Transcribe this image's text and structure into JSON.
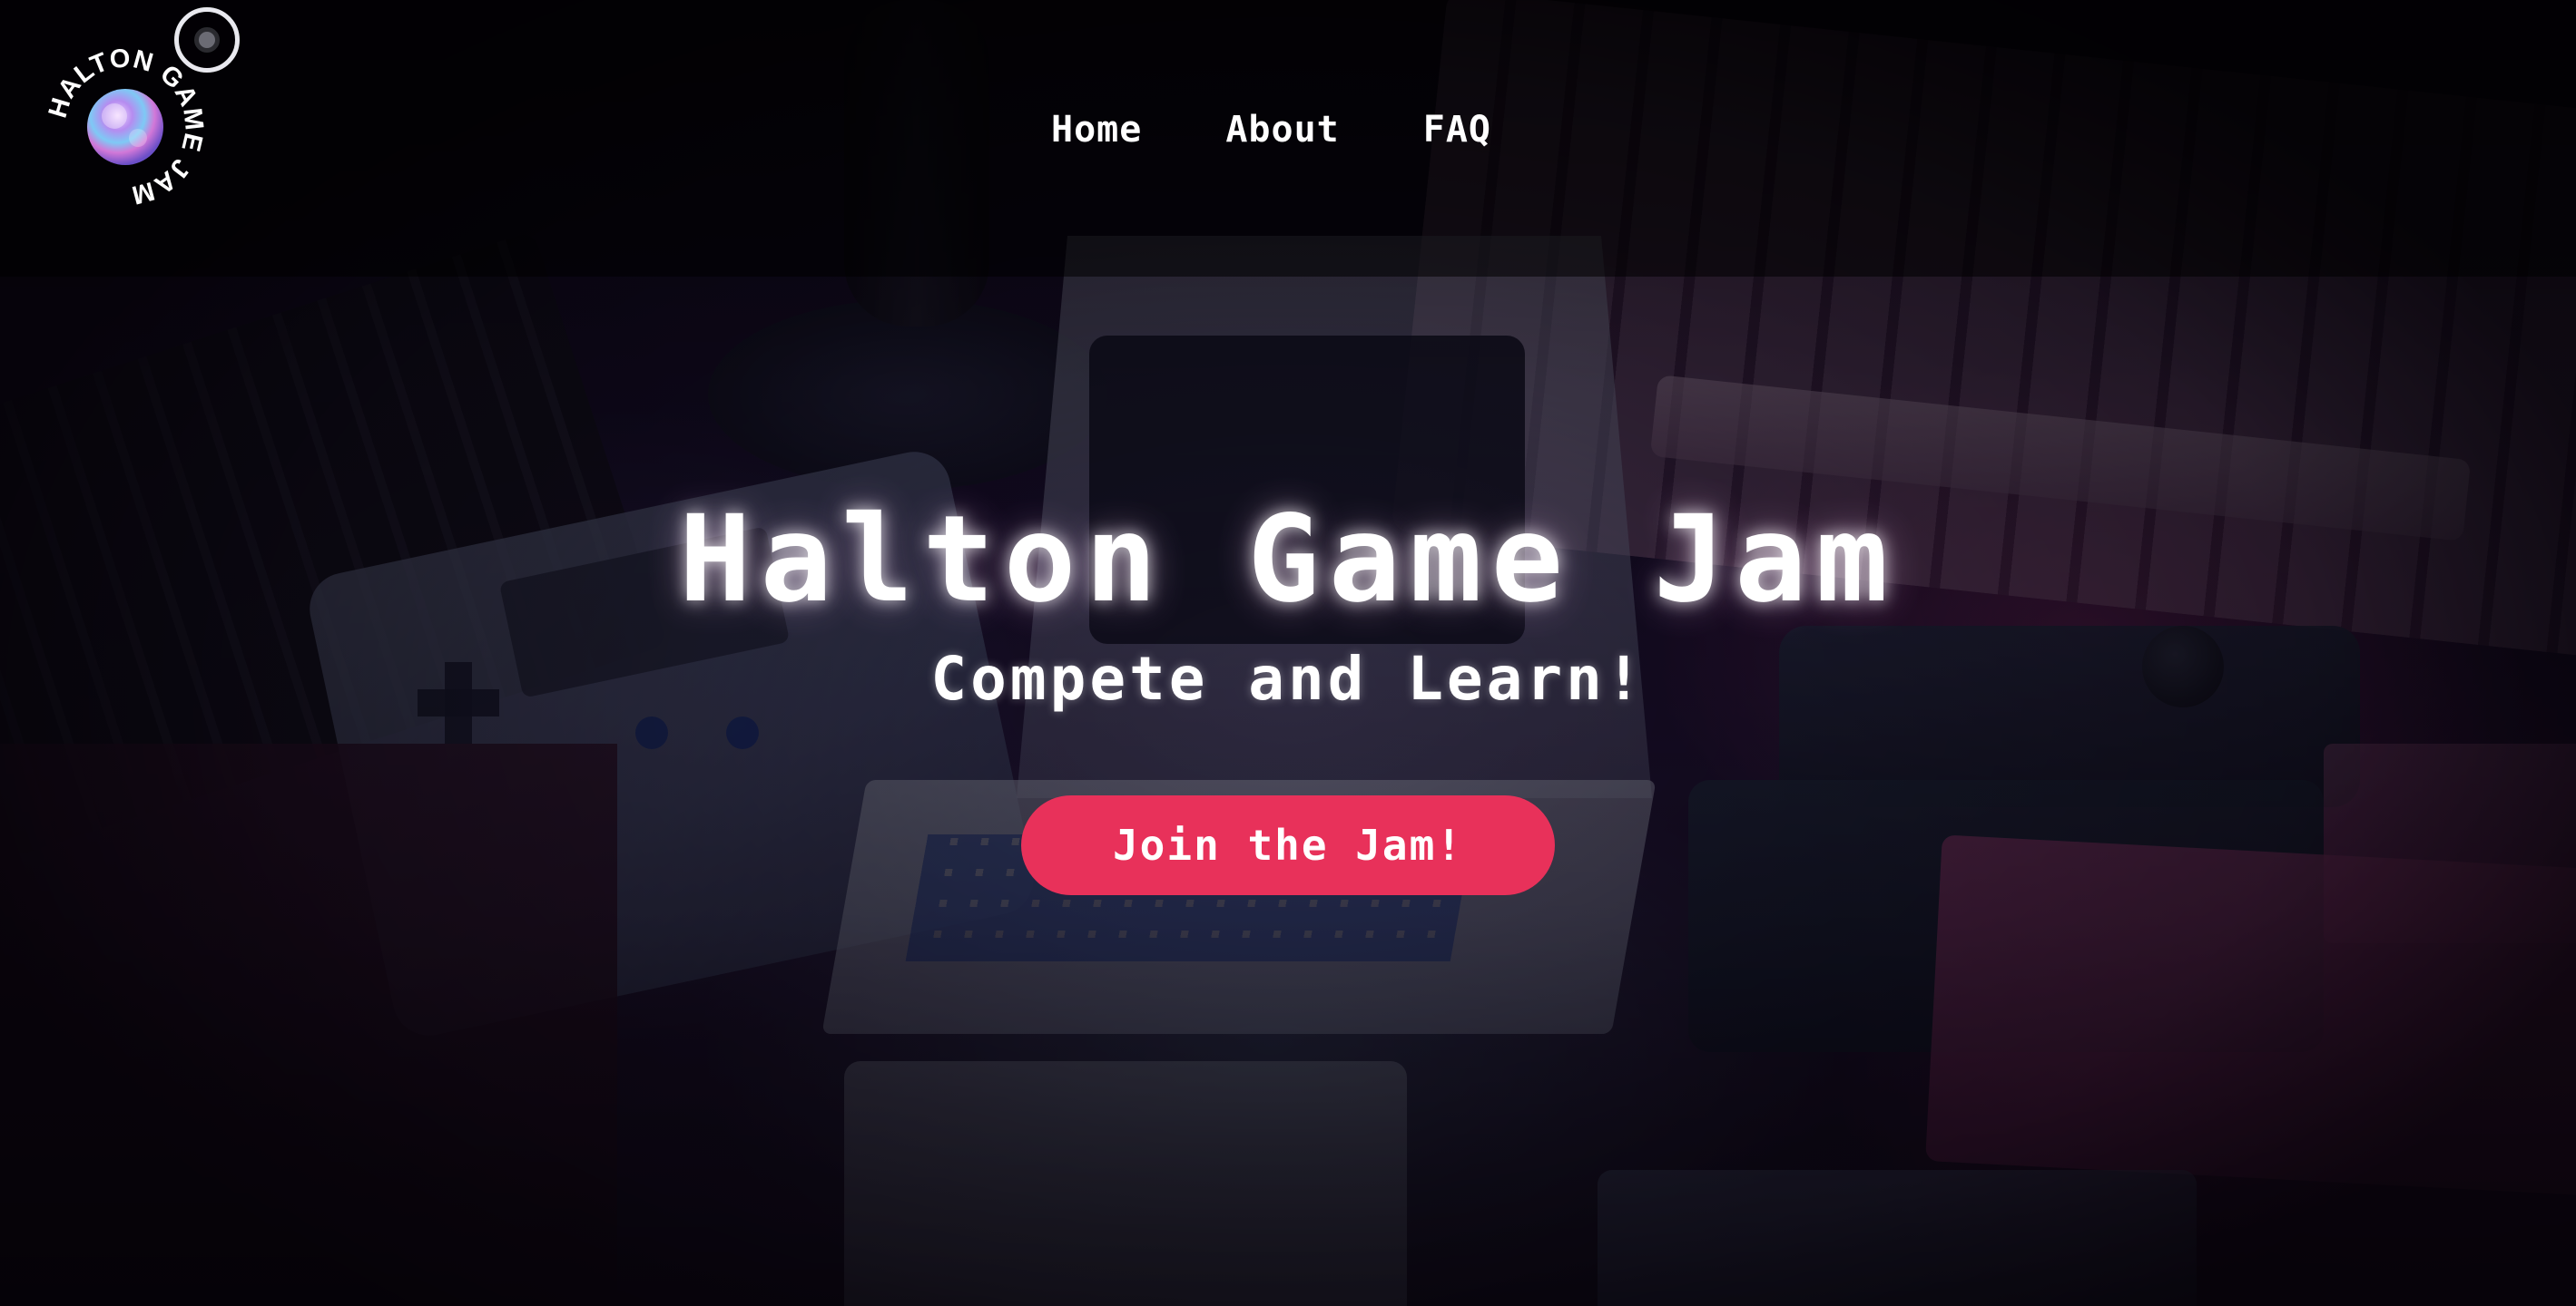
{
  "header": {
    "logo": {
      "text": "HALTON GAME JAM",
      "icon": "halton-game-jam-badge-logo"
    },
    "nav": {
      "items": [
        {
          "label": "Home"
        },
        {
          "label": "About"
        },
        {
          "label": "FAQ"
        }
      ]
    },
    "toggle_icon": "circle-toggle-icon"
  },
  "hero": {
    "title": "Halton Game Jam",
    "subtitle": "Compete and Learn!",
    "cta_label": "Join the Jam!"
  },
  "colors": {
    "accent": "#e8315a",
    "text": "#ffffff",
    "header_bg": "#000000"
  }
}
